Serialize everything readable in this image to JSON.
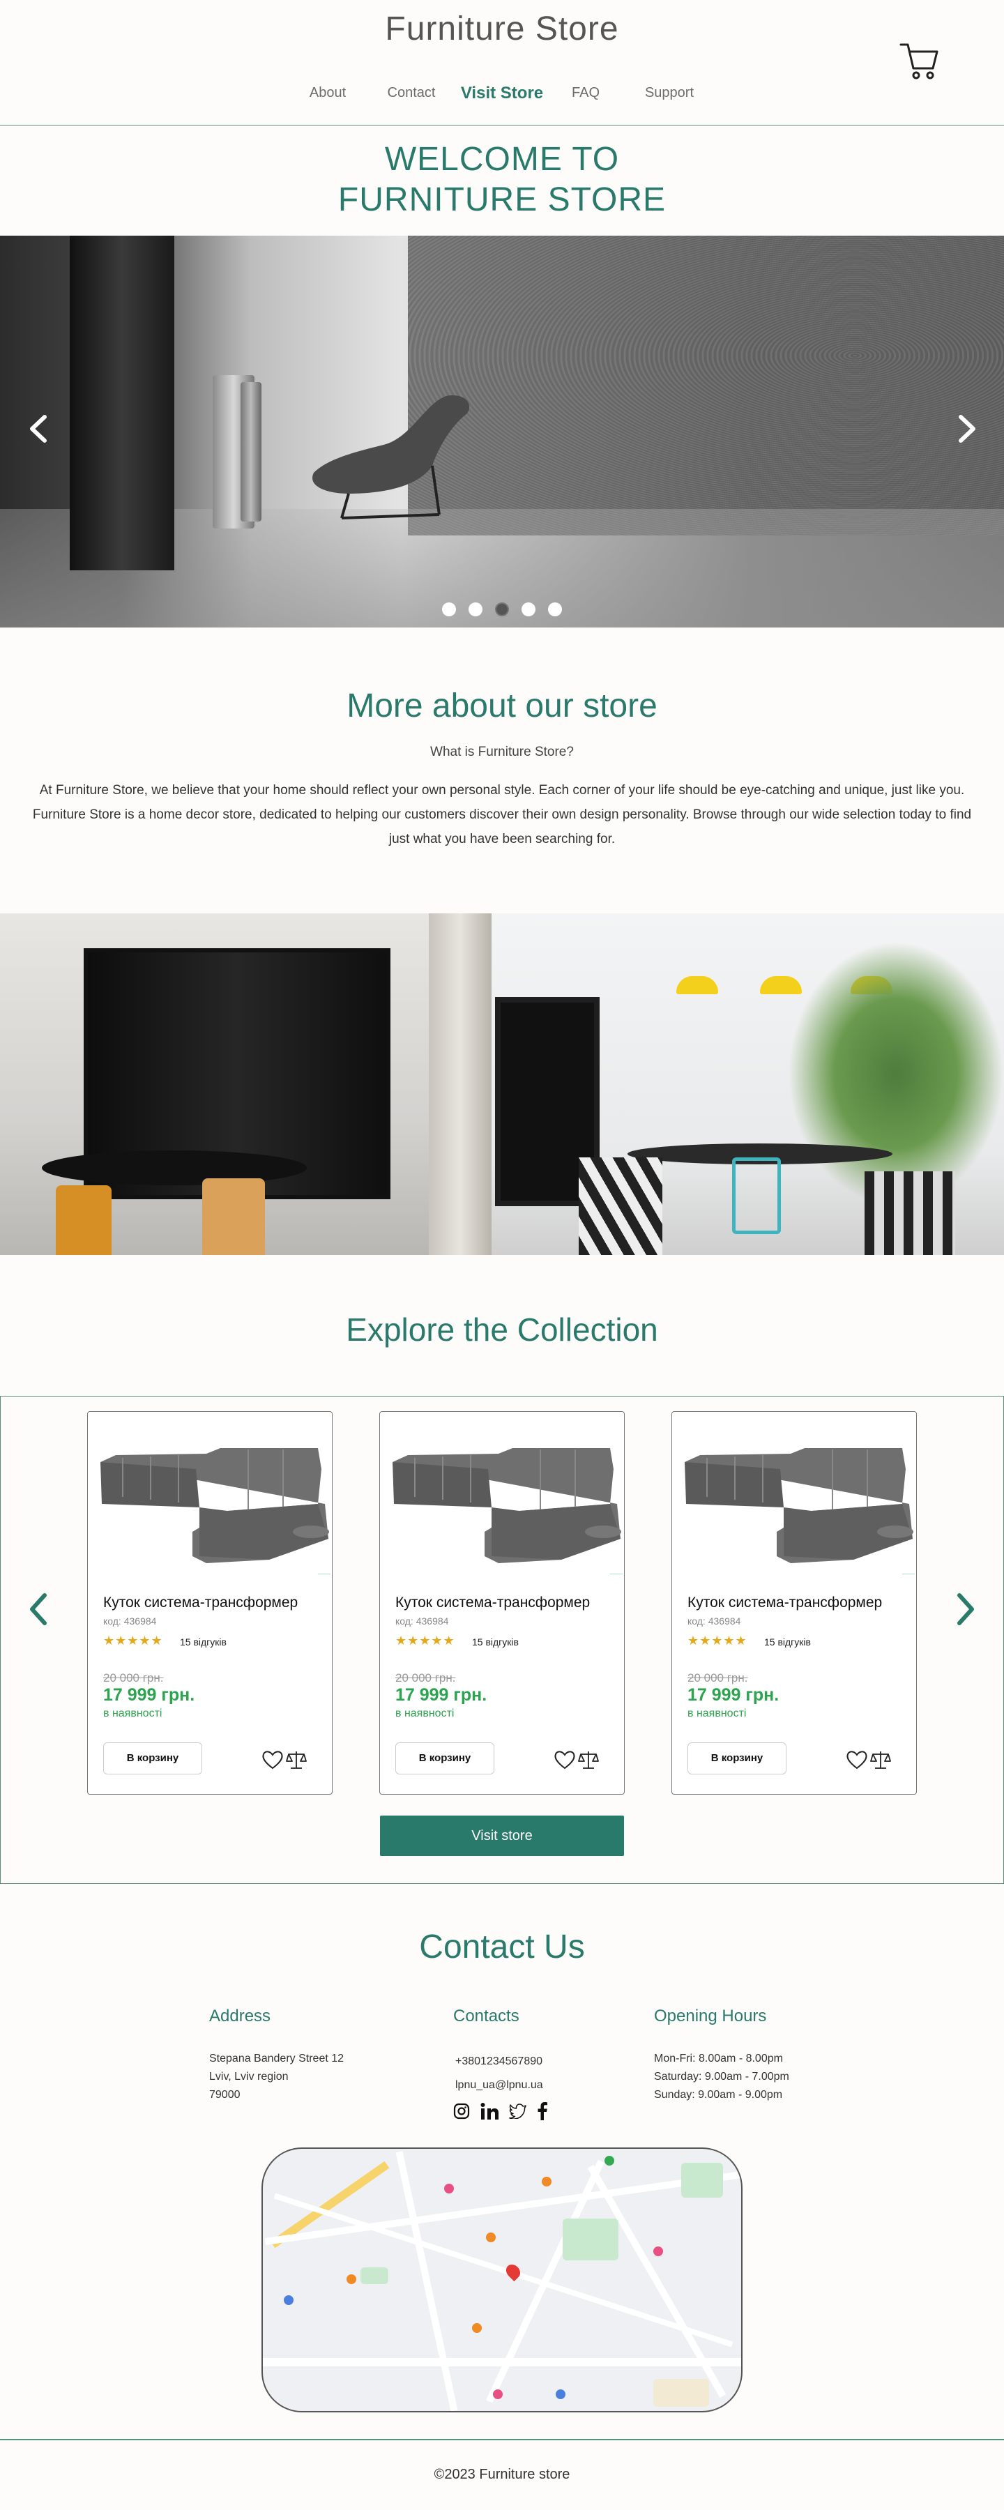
{
  "header": {
    "logo": "Furniture Store",
    "nav": [
      {
        "label": "About"
      },
      {
        "label": "Contact"
      },
      {
        "label": "Visit Store",
        "active": true
      },
      {
        "label": "FAQ"
      },
      {
        "label": "Support"
      }
    ],
    "cart_icon": "cart-icon"
  },
  "welcome": {
    "line1": "WELCOME TO",
    "line2": "FURNITURE STORE"
  },
  "hero": {
    "slides": 5,
    "active_slide": 3,
    "prev_icon": "chevron-left-icon",
    "next_icon": "chevron-right-icon"
  },
  "about": {
    "title": "More about our store",
    "subtitle": "What is Furniture Store?",
    "text": "At Furniture Store, we believe that your home should reflect your own personal style. Each corner of your life should be eye-catching and unique, just like you. Furniture Store is a home decor store, dedicated to helping our customers discover their own design personality. Browse through our wide selection today to find just what you have been searching for."
  },
  "collection": {
    "title": "Explore the Collection",
    "products": [
      {
        "name": "Куток система-трансформер",
        "code": "код: 436984",
        "rating": 5,
        "reviews": "15 відгуків",
        "old_price": "20 000 грн.",
        "price": "17 999 грн.",
        "availability": "в наявності",
        "cart_button": "В корзину"
      },
      {
        "name": "Куток система-трансформер",
        "code": "код: 436984",
        "rating": 5,
        "reviews": "15 відгуків",
        "old_price": "20 000 грн.",
        "price": "17 999 грн.",
        "availability": "в наявності",
        "cart_button": "В корзину"
      },
      {
        "name": "Куток система-трансформер",
        "code": "код: 436984",
        "rating": 5,
        "reviews": "15 відгуків",
        "old_price": "20 000 грн.",
        "price": "17 999 грн.",
        "availability": "в наявності",
        "cart_button": "В корзину"
      }
    ],
    "visit_button": "Visit store",
    "colors": {
      "accent": "#2a7a6b",
      "price": "#2ca34f",
      "stars": "#e6a817"
    }
  },
  "contact": {
    "title": "Contact Us",
    "address": {
      "heading": "Address",
      "line1": "Stepana Bandery Street 12",
      "line2": "Lviv, Lviv region",
      "line3": "79000"
    },
    "contacts": {
      "heading": "Contacts",
      "phone": "+3801234567890",
      "email": "lpnu_ua@lpnu.ua",
      "socials": [
        "instagram-icon",
        "linkedin-icon",
        "twitter-icon",
        "facebook-icon"
      ]
    },
    "hours": {
      "heading": "Opening Hours",
      "line1": "Mon-Fri: 8.00am - 8.00pm",
      "line2": "Saturday: 9.00am - 7.00pm",
      "line3": "Sunday: 9.00am - 9.00pm"
    }
  },
  "footer": {
    "text": "©2023 Furniture store"
  }
}
